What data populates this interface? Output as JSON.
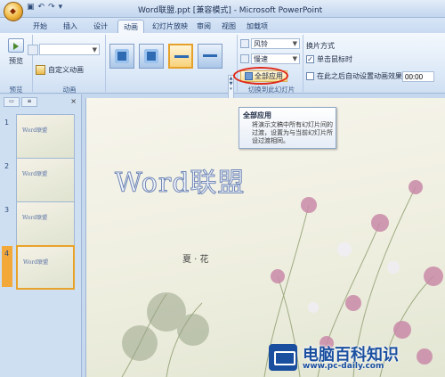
{
  "window": {
    "title": "Word联盟.ppt [兼容模式] - Microsoft PowerPoint",
    "qat_icons": [
      "save-icon",
      "undo-icon",
      "redo-icon",
      "customize-icon"
    ]
  },
  "tabs": [
    "开始",
    "插入",
    "设计",
    "动画",
    "幻灯片放映",
    "审阅",
    "视图",
    "加载项"
  ],
  "active_tab": "动画",
  "ribbon": {
    "preview": {
      "label": "预览",
      "group": "预览"
    },
    "animation": {
      "select_value": "",
      "custom_label": "自定义动画",
      "group": "动画"
    },
    "transition": {
      "group": "切换到此幻灯片",
      "sound_value": "风铃",
      "speed_value": "慢速",
      "apply_all_label": "全部应用",
      "thumb_count": 4,
      "selected_index": 2
    },
    "advance": {
      "title": "换片方式",
      "on_click_label": "单击鼠标时",
      "on_click_checked": true,
      "auto_label": "在此之后自动设置动画效果:",
      "auto_checked": false,
      "time_value": "00:00"
    }
  },
  "tooltip": {
    "title": "全部应用",
    "body": "将演示文稿中所有幻灯片间的过渡，设置为与当前幻灯片所设过渡相同。"
  },
  "slides_pane": {
    "slides": [
      {
        "num": "1",
        "text": "Word联盟"
      },
      {
        "num": "2",
        "text": "Word联盟"
      },
      {
        "num": "3",
        "text": "Word联盟"
      },
      {
        "num": "4",
        "text": "Word联盟"
      }
    ],
    "selected": 4
  },
  "slide": {
    "title": "Word联盟",
    "subtitle": "夏 · 花"
  },
  "watermark": {
    "title": "电脑百科知识",
    "url": "www.pc-daily.com"
  },
  "colors": {
    "accent": "#e6a12a",
    "highlight_ring": "#e02a1a",
    "watermark_blue": "#1a4fa0"
  }
}
